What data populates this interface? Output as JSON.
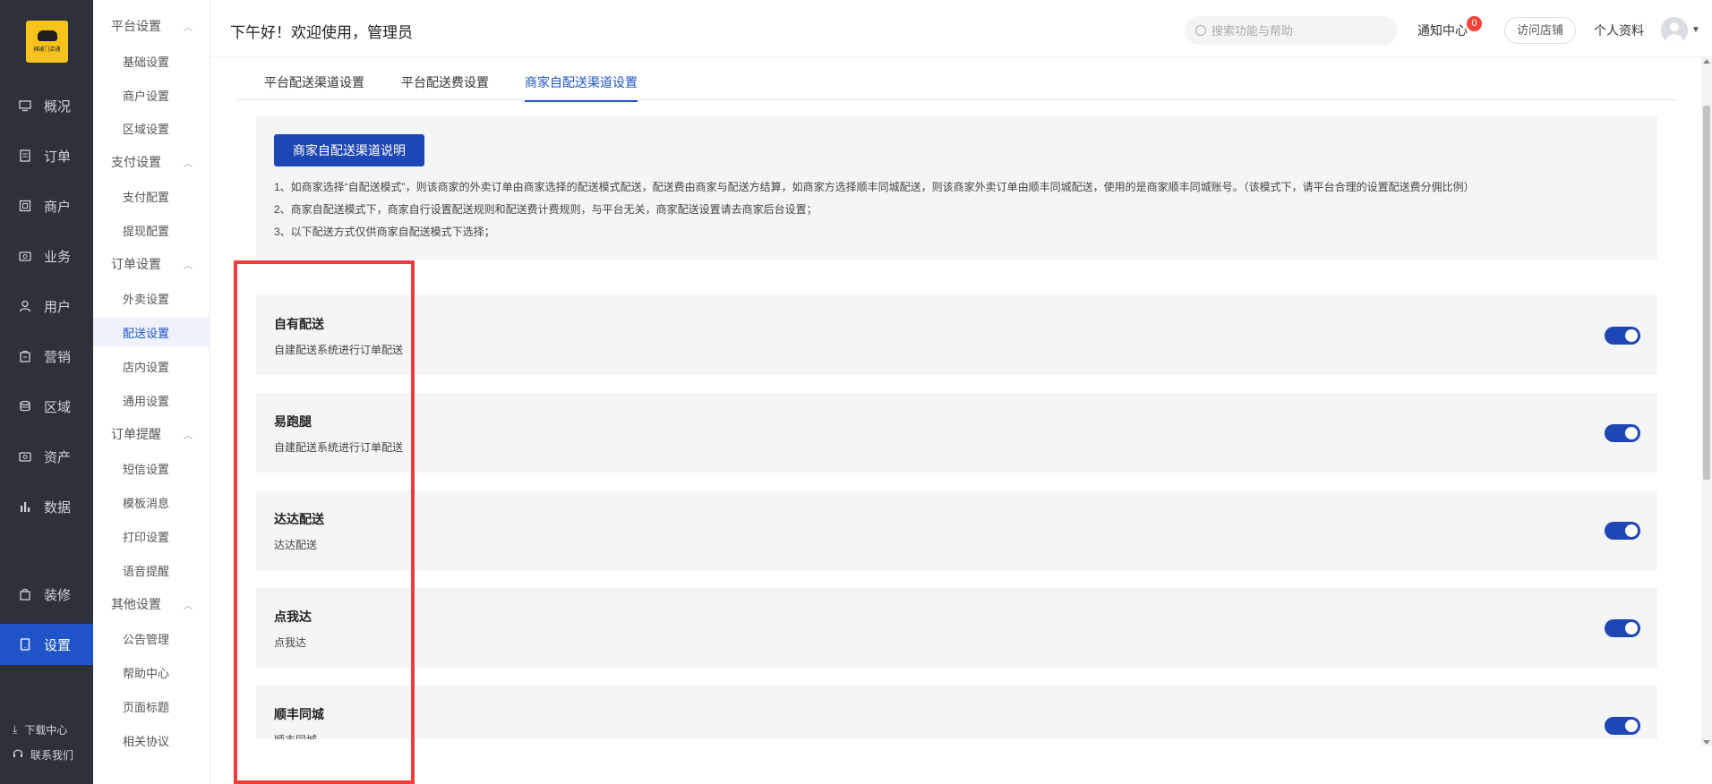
{
  "app": {
    "logo_text": "棉被门店通"
  },
  "nav": {
    "items": [
      {
        "label": "概况",
        "icon": "monitor-icon"
      },
      {
        "label": "订单",
        "icon": "order-icon"
      },
      {
        "label": "商户",
        "icon": "store-icon"
      },
      {
        "label": "业务",
        "icon": "business-icon"
      },
      {
        "label": "用户",
        "icon": "user-icon"
      },
      {
        "label": "营销",
        "icon": "marketing-icon"
      },
      {
        "label": "区域",
        "icon": "region-icon"
      },
      {
        "label": "资产",
        "icon": "asset-icon"
      },
      {
        "label": "数据",
        "icon": "chart-icon"
      },
      {
        "label": "装修",
        "icon": "decorate-icon"
      },
      {
        "label": "设置",
        "icon": "settings-icon",
        "active": true
      }
    ],
    "footer": {
      "download": "下载中心",
      "contact": "联系我们"
    }
  },
  "submenu": {
    "platform_group": "平台设置",
    "platform_items": [
      "基础设置",
      "商户设置",
      "区域设置"
    ],
    "payment_group": "支付设置",
    "payment_items": [
      "支付配置",
      "提现配置"
    ],
    "order_group": "订单设置",
    "order_items": [
      "外卖设置",
      "配送设置",
      "店内设置",
      "通用设置"
    ],
    "reminder_group": "订单提醒",
    "reminder_items": [
      "短信设置",
      "模板消息",
      "打印设置",
      "语音提醒"
    ],
    "other_group": "其他设置",
    "other_items": [
      "公告管理",
      "帮助中心",
      "页面标题",
      "相关协议"
    ]
  },
  "header": {
    "greeting": "下午好！欢迎使用，管理员",
    "search_placeholder": "搜索功能与帮助",
    "notice_label": "通知中心",
    "notice_count": "0",
    "visit_store": "访问店铺",
    "profile": "个人资料"
  },
  "tabs": [
    {
      "label": "平台配送渠道设置"
    },
    {
      "label": "平台配送费设置"
    },
    {
      "label": "商家自配送渠道设置",
      "active": true
    }
  ],
  "info": {
    "button": "商家自配送渠道说明",
    "lines": [
      "1、如商家选择“自配送模式”，则该商家的外卖订单由商家选择的配送模式配送，配送费由商家与配送方结算，如商家方选择顺丰同城配送，则该商家外卖订单由顺丰同城配送，使用的是商家顺丰同城账号。（该模式下，请平台合理的设置配送费分佣比例）",
      "2、商家自配送模式下，商家自行设置配送规则和配送费计费规则，与平台无关，商家配送设置请去商家后台设置；",
      "3、以下配送方式仅供商家自配送模式下选择；"
    ]
  },
  "channels": [
    {
      "name": "自有配送",
      "desc": "自建配送系统进行订单配送",
      "enabled": true
    },
    {
      "name": "易跑腿",
      "desc": "自建配送系统进行订单配送",
      "enabled": true
    },
    {
      "name": "达达配送",
      "desc": "达达配送",
      "enabled": true
    },
    {
      "name": "点我达",
      "desc": "点我达",
      "enabled": true
    },
    {
      "name": "顺丰同城",
      "desc": "顺丰同城",
      "enabled": true
    }
  ],
  "colors": {
    "primary": "#1f46b5",
    "nav_bg": "#2d3139",
    "nav_active": "#1f54c9",
    "highlight": "#f23c3c",
    "badge": "#f5423a"
  }
}
